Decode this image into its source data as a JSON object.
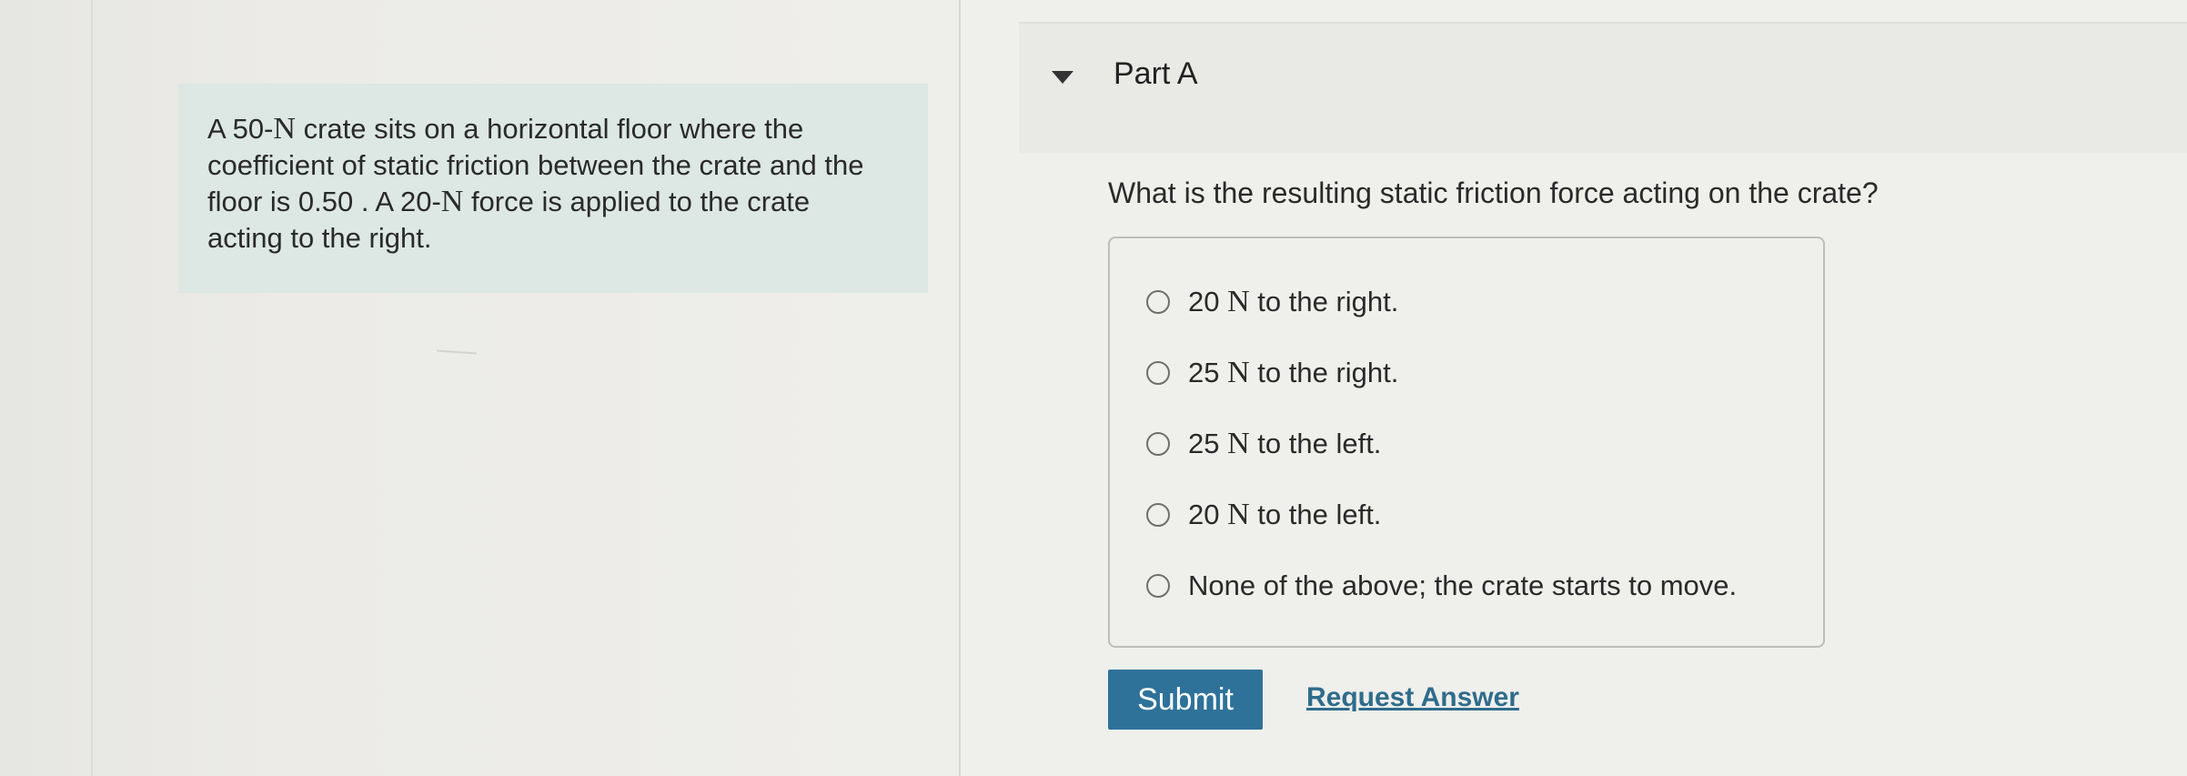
{
  "problem": {
    "text_pre1": "A 50-",
    "unit1": "N",
    "text_mid1": " crate sits on a horizontal floor where the coefficient of static friction between the crate and the floor is 0.50 . A 20-",
    "unit2": "N",
    "text_post": " force is applied to the crate acting to the right."
  },
  "part": {
    "title": "Part A",
    "toggle_icon": "caret-down-icon"
  },
  "question": "What is the resulting static friction force acting on the crate?",
  "options": [
    {
      "value": "20 ",
      "unit": "N",
      "suffix": " to the right."
    },
    {
      "value": "25 ",
      "unit": "N",
      "suffix": " to the right."
    },
    {
      "value": "25 ",
      "unit": "N",
      "suffix": " to the left."
    },
    {
      "value": "20 ",
      "unit": "N",
      "suffix": " to the left."
    },
    {
      "value": "",
      "unit": "",
      "suffix": "None of the above; the crate starts to move."
    }
  ],
  "buttons": {
    "submit": "Submit",
    "request_answer": "Request Answer"
  },
  "colors": {
    "submit_bg": "#2f7299",
    "link": "#2f6c8c",
    "problem_bg": "#dde7e4"
  }
}
